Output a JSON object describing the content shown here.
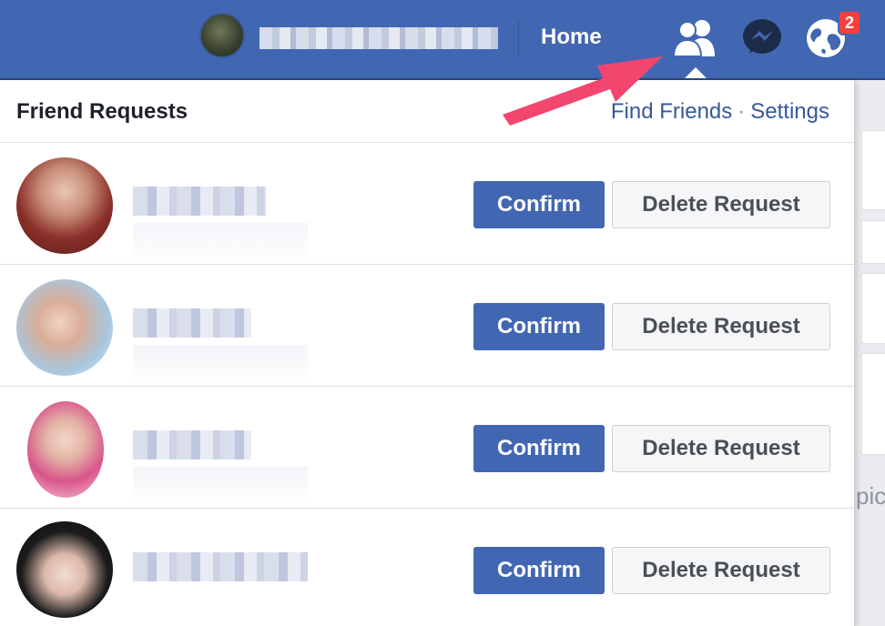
{
  "topbar": {
    "home_label": "Home",
    "notification_count": "2",
    "profile_name_redacted": true
  },
  "friend_requests": {
    "title": "Friend Requests",
    "find_friends_label": "Find Friends",
    "separator": "·",
    "settings_label": "Settings",
    "requests": [
      {
        "name_redacted": true,
        "confirm_label": "Confirm",
        "delete_label": "Delete Request"
      },
      {
        "name_redacted": true,
        "confirm_label": "Confirm",
        "delete_label": "Delete Request"
      },
      {
        "name_redacted": true,
        "confirm_label": "Confirm",
        "delete_label": "Delete Request"
      },
      {
        "name_redacted": true,
        "confirm_label": "Confirm",
        "delete_label": "Delete Request"
      }
    ]
  },
  "background": {
    "partial_text": "pic"
  },
  "colors": {
    "brand_blue": "#4267b2",
    "link_blue": "#365899",
    "badge_red": "#fa3e3e",
    "annotation_arrow": "#f2466e"
  },
  "icons": {
    "friends": "friends-icon",
    "messenger": "messenger-icon",
    "notifications": "globe-icon"
  }
}
